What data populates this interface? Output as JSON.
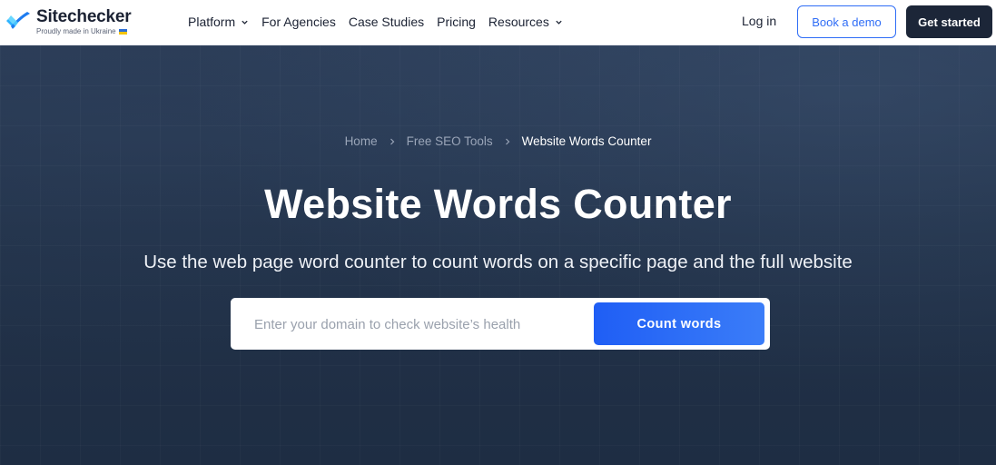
{
  "brand": {
    "name": "Sitechecker",
    "tagline": "Proudly made in Ukraine",
    "colors": {
      "primary": "#2f6df6",
      "dark": "#1c2638",
      "logo_blue": "#1e9bf0"
    }
  },
  "nav": {
    "items": [
      {
        "label": "Platform",
        "has_dropdown": true
      },
      {
        "label": "For Agencies",
        "has_dropdown": false
      },
      {
        "label": "Case Studies",
        "has_dropdown": false
      },
      {
        "label": "Pricing",
        "has_dropdown": false
      },
      {
        "label": "Resources",
        "has_dropdown": true
      }
    ],
    "login_label": "Log in",
    "demo_label": "Book a demo",
    "start_label": "Get started"
  },
  "breadcrumb": {
    "items": [
      "Home",
      "Free SEO Tools",
      "Website Words Counter"
    ]
  },
  "hero": {
    "title": "Website Words Counter",
    "subtitle": "Use the web page word counter to count words on a specific page and the full website"
  },
  "search": {
    "placeholder": "Enter your domain to check website’s health",
    "value": "",
    "button_label": "Count words"
  }
}
